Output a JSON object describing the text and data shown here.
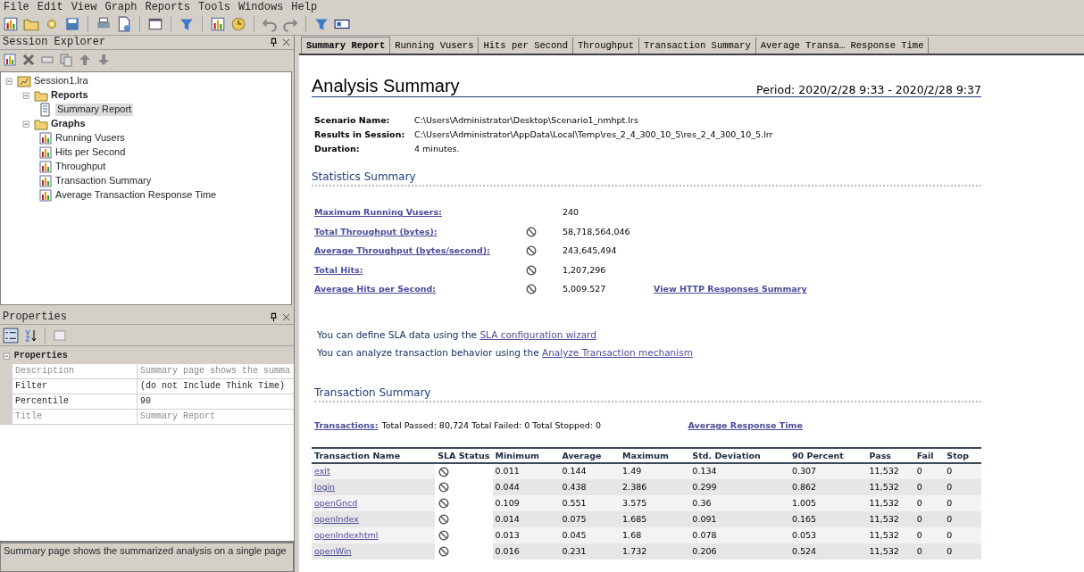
{
  "menu": [
    "File",
    "Edit",
    "View",
    "Graph",
    "Reports",
    "Tools",
    "Windows",
    "Help"
  ],
  "session_explorer": {
    "title": "Session Explorer",
    "tree": [
      {
        "label": "Session1.lra",
        "kind": "session",
        "expanded": true,
        "children": [
          {
            "label": "Reports",
            "kind": "folder",
            "expanded": true,
            "children": [
              {
                "label": "Summary Report",
                "kind": "report",
                "selected": true
              }
            ]
          },
          {
            "label": "Graphs",
            "kind": "folder",
            "expanded": true,
            "children": [
              {
                "label": "Running Vusers",
                "kind": "graph",
                "selected": false
              },
              {
                "label": "Hits per Second",
                "kind": "graph",
                "selected": false
              },
              {
                "label": "Throughput",
                "kind": "graph",
                "selected": false
              },
              {
                "label": "Transaction Summary",
                "kind": "graph",
                "selected": false
              },
              {
                "label": "Average Transaction Response Time",
                "kind": "graph",
                "selected": false
              }
            ]
          }
        ]
      }
    ]
  },
  "properties": {
    "title": "Properties",
    "category": "Properties",
    "rows": [
      {
        "name": "Description",
        "value": "Summary page shows the summa",
        "disabled": true
      },
      {
        "name": "Filter",
        "value": "(do not Include Think Time)",
        "disabled": false
      },
      {
        "name": "Percentile",
        "value": "90",
        "disabled": false
      },
      {
        "name": "Title",
        "value": "Summary Report",
        "disabled": true
      }
    ],
    "description": "Summary page shows the summarized analysis on a single page"
  },
  "tabs": [
    {
      "label": "Summary Report",
      "selected": true
    },
    {
      "label": "Running Vusers",
      "selected": false
    },
    {
      "label": "Hits per Second",
      "selected": false
    },
    {
      "label": "Throughput",
      "selected": false
    },
    {
      "label": "Transaction Summary",
      "selected": false
    },
    {
      "label": "Average Transa… Response Time",
      "selected": false
    }
  ],
  "report": {
    "title": "Analysis Summary",
    "period": "Period: 2020/2/28 9:33 - 2020/2/28 9:37",
    "info": [
      {
        "label": "Scenario Name:",
        "value": "C:\\Users\\Administrator\\Desktop\\Scenario1_nmhpt.lrs"
      },
      {
        "label": "Results in Session:",
        "value": "C:\\Users\\Administrator\\AppData\\Local\\Temp\\res_2_4_300_10_5\\res_2_4_300_10_5.lrr"
      },
      {
        "label": "Duration:",
        "value": "4 minutes."
      }
    ],
    "statistics_heading": "Statistics Summary",
    "statistics": [
      {
        "label": "Maximum Running Vusers:",
        "sla_icon": false,
        "value": "240"
      },
      {
        "label": "Total Throughput (bytes):",
        "sla_icon": true,
        "value": "58,718,564,046"
      },
      {
        "label": "Average Throughput (bytes/second):",
        "sla_icon": true,
        "value": "243,645,494"
      },
      {
        "label": "Total Hits:",
        "sla_icon": true,
        "value": "1,207,296"
      },
      {
        "label": "Average Hits per Second:",
        "sla_icon": true,
        "value": "5,009.527",
        "link": "View HTTP Responses Summary"
      }
    ],
    "notes": [
      {
        "text": "You can define SLA data using the",
        "link": "SLA configuration wizard"
      },
      {
        "text": "You can analyze transaction behavior using the",
        "link": "Analyze Transaction mechanism"
      }
    ],
    "transaction_heading": "Transaction Summary",
    "transactions_link": "Transactions:",
    "transactions_text": "Total Passed: 80,724 Total Failed: 0 Total Stopped: 0",
    "response_link": "Average Response Time",
    "table": {
      "columns": [
        "Transaction Name",
        "SLA Status",
        "Minimum",
        "Average",
        "Maximum",
        "Std. Deviation",
        "90 Percent",
        "Pass",
        "Fail",
        "Stop"
      ],
      "rows": [
        [
          "exit",
          "",
          "0.011",
          "0.144",
          "1.49",
          "0.134",
          "0.307",
          "11,532",
          "0",
          "0"
        ],
        [
          "login",
          "",
          "0.044",
          "0.438",
          "2.386",
          "0.299",
          "0.862",
          "11,532",
          "0",
          "0"
        ],
        [
          "openGncd",
          "",
          "0.109",
          "0.551",
          "3.575",
          "0.36",
          "1.005",
          "11,532",
          "0",
          "0"
        ],
        [
          "openIndex",
          "",
          "0.014",
          "0.075",
          "1.685",
          "0.091",
          "0.165",
          "11,532",
          "0",
          "0"
        ],
        [
          "openIndexhtml",
          "",
          "0.013",
          "0.045",
          "1.68",
          "0.078",
          "0.053",
          "11,532",
          "0",
          "0"
        ],
        [
          "openWin",
          "",
          "0.016",
          "0.231",
          "1.732",
          "0.206",
          "0.524",
          "11,532",
          "0",
          "0"
        ]
      ]
    }
  }
}
